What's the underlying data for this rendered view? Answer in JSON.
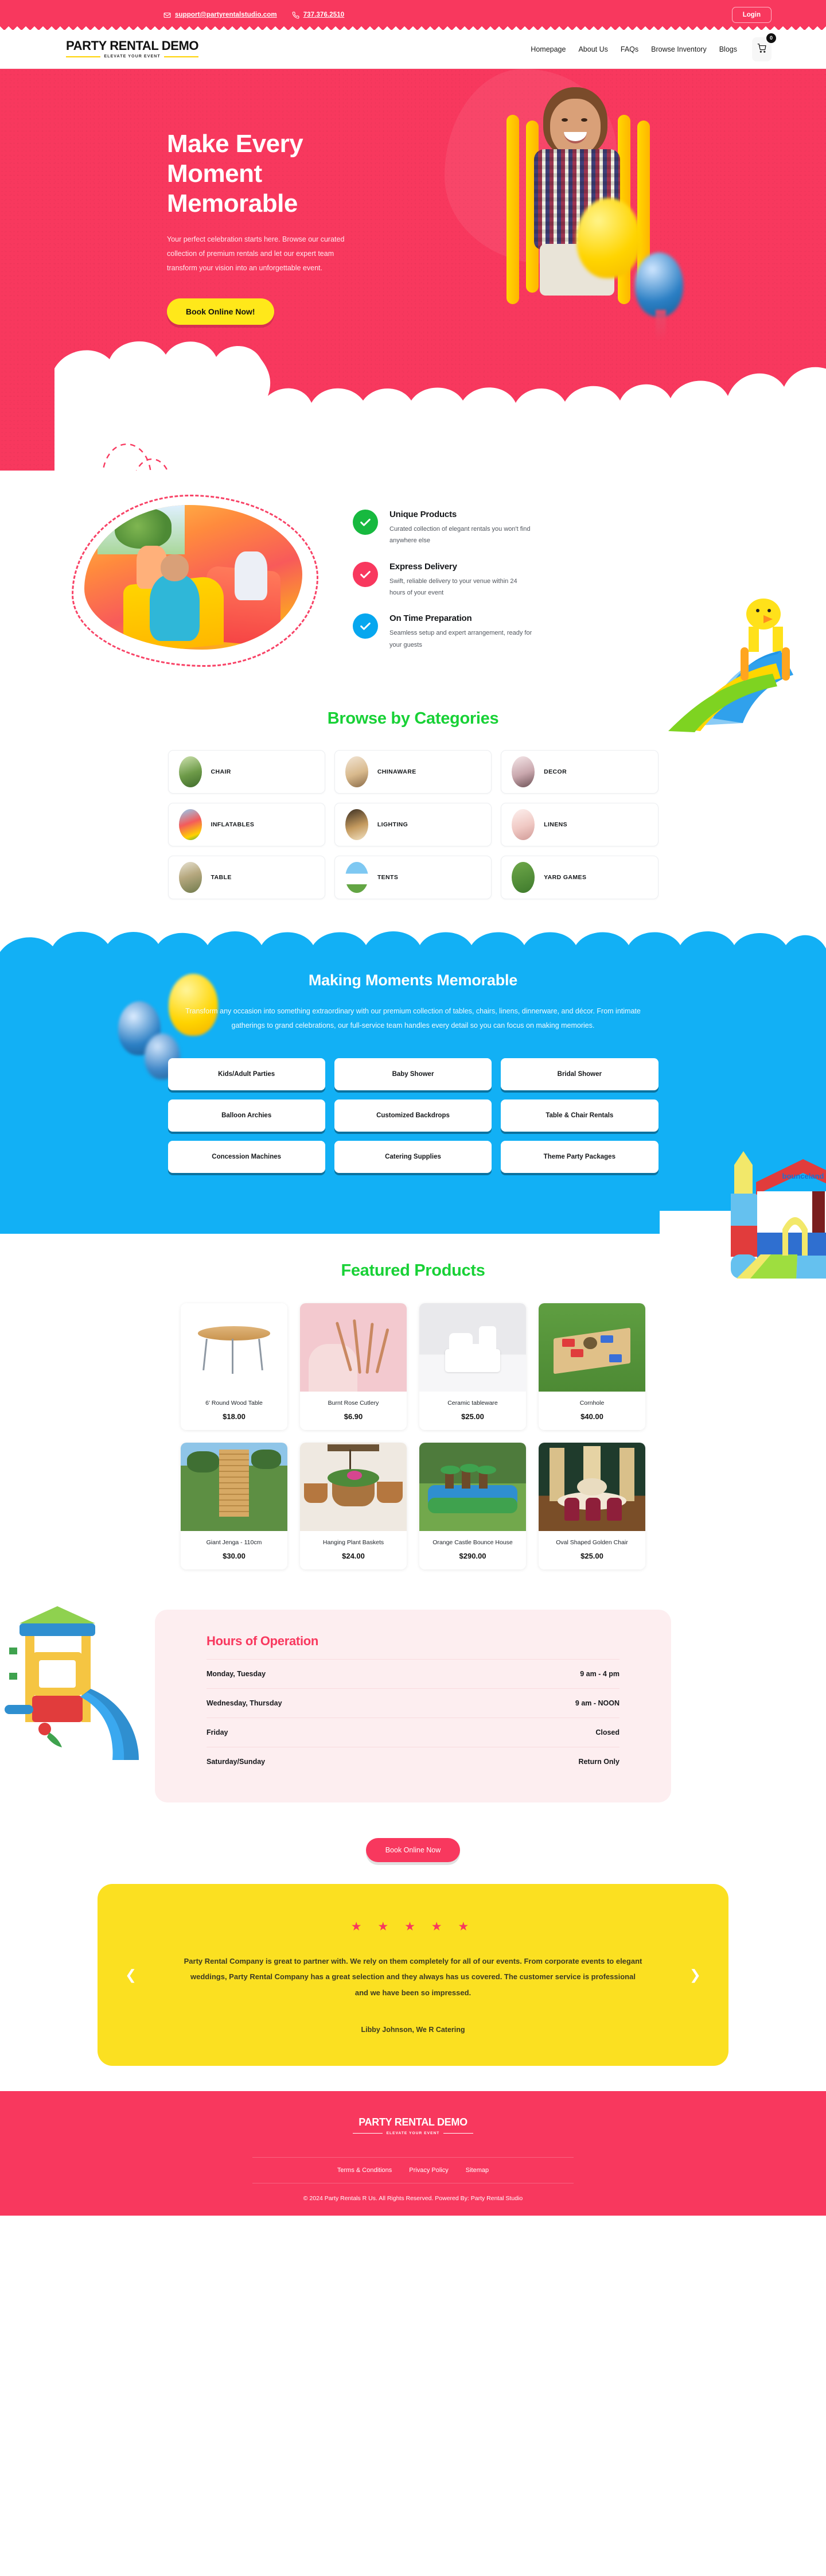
{
  "topbar": {
    "email": "support@partyrentalstudio.com",
    "phone": "737.376.2510",
    "login_label": "Login"
  },
  "header": {
    "logo_main": "PARTY RENTAL DEMO",
    "logo_sub": "ELEVATE YOUR EVENT",
    "nav": [
      {
        "label": "Homepage"
      },
      {
        "label": "About Us"
      },
      {
        "label": "FAQs"
      },
      {
        "label": "Browse Inventory"
      },
      {
        "label": "Blogs"
      }
    ],
    "cart_count": "0"
  },
  "hero": {
    "title_line1": "Make Every",
    "title_line2": "Moment",
    "title_line3": "Memorable",
    "description": "Your perfect celebration starts here. Browse our curated collection of premium rentals and let our expert team transform your vision into an unforgettable event.",
    "cta_label": "Book Online Now!"
  },
  "features": [
    {
      "title": "Unique Products",
      "text": "Curated collection of elegant rentals you won't find anywhere else",
      "color": "#17b93f"
    },
    {
      "title": "Express Delivery",
      "text": "Swift, reliable delivery to your venue within 24 hours of your event",
      "color": "#f8385e"
    },
    {
      "title": "On Time Preparation",
      "text": "Seamless setup and expert arrangement, ready for your guests",
      "color": "#06a7ef"
    }
  ],
  "categories": {
    "title": "Browse by Categories",
    "items": [
      {
        "label": "CHAIR"
      },
      {
        "label": "CHINAWARE"
      },
      {
        "label": "DECOR"
      },
      {
        "label": "INFLATABLES"
      },
      {
        "label": "LIGHTING"
      },
      {
        "label": "LINENS"
      },
      {
        "label": "TABLE"
      },
      {
        "label": "TENTS"
      },
      {
        "label": "YARD GAMES"
      }
    ]
  },
  "blue_section": {
    "title": "Making Moments Memorable",
    "description": "Transform any occasion into something extraordinary with our premium collection of tables, chairs, linens, dinnerware, and décor. From intimate gatherings to grand celebrations, our full-service team handles every detail so you can focus on making memories.",
    "items": [
      {
        "label": "Kids/Adult Parties"
      },
      {
        "label": "Baby Shower"
      },
      {
        "label": "Bridal Shower"
      },
      {
        "label": "Balloon Archies"
      },
      {
        "label": "Customized Backdrops"
      },
      {
        "label": "Table & Chair Rentals"
      },
      {
        "label": "Concession Machines"
      },
      {
        "label": "Catering Supplies"
      },
      {
        "label": "Theme Party Packages"
      }
    ]
  },
  "featured": {
    "title": "Featured Products",
    "products": [
      {
        "name": "6' Round Wood Table",
        "price": "$18.00"
      },
      {
        "name": "Burnt Rose Cutlery",
        "price": "$6.90"
      },
      {
        "name": "Ceramic tableware",
        "price": "$25.00"
      },
      {
        "name": "Cornhole",
        "price": "$40.00"
      },
      {
        "name": "Giant Jenga - 110cm",
        "price": "$30.00"
      },
      {
        "name": "Hanging Plant Baskets",
        "price": "$24.00"
      },
      {
        "name": "Orange Castle Bounce House",
        "price": "$290.00"
      },
      {
        "name": "Oval Shaped Golden Chair",
        "price": "$25.00"
      }
    ]
  },
  "hours": {
    "title": "Hours of Operation",
    "rows": [
      {
        "day": "Monday, Tuesday",
        "time": "9 am - 4 pm"
      },
      {
        "day": "Wednesday, Thursday",
        "time": "9 am - NOON"
      },
      {
        "day": "Friday",
        "time": "Closed"
      },
      {
        "day": "Saturday/Sunday",
        "time": "Return Only"
      }
    ]
  },
  "book_cta": {
    "label": "Book Online Now"
  },
  "testimonial": {
    "stars": "★ ★ ★ ★ ★",
    "text": "Party Rental Company is great to partner with. We rely on them completely for all of our events.  From corporate events to elegant weddings, Party Rental Company has a great selection and they always has us covered.  The customer service is professional and we have been so impressed.",
    "author": "Libby Johnson, We R Catering",
    "prev_label": "❮",
    "next_label": "❯"
  },
  "footer": {
    "logo_main": "PARTY RENTAL DEMO",
    "logo_sub": "ELEVATE YOUR EVENT",
    "links": [
      {
        "label": "Terms & Conditions"
      },
      {
        "label": "Privacy Policy"
      },
      {
        "label": "Sitemap"
      }
    ],
    "copyright": "© 2024 Party Rentals R Us. All Rights Reserved. Powered By: Party Rental Studio"
  },
  "colors": {
    "brand_pink": "#f8385e",
    "accent_yellow": "#ffe81a",
    "accent_blue": "#12b0f5",
    "accent_green": "#18d136"
  }
}
